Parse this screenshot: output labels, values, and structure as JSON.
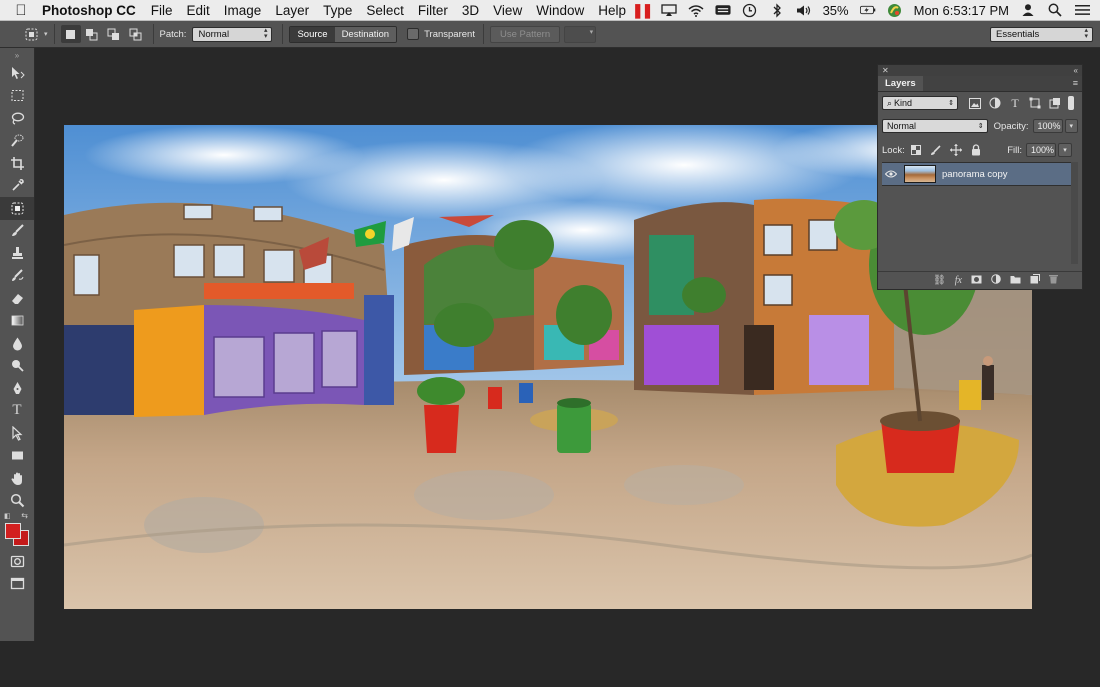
{
  "menubar": {
    "app_name": "Photoshop CC",
    "menus": [
      "File",
      "Edit",
      "Image",
      "Layer",
      "Type",
      "Select",
      "Filter",
      "3D",
      "View",
      "Window",
      "Help"
    ],
    "battery": "35%",
    "clock": "Mon 6:53:17 PM"
  },
  "options_bar": {
    "patch_label": "Patch:",
    "patch_mode": "Normal",
    "source_label": "Source",
    "destination_label": "Destination",
    "transparent_label": "Transparent",
    "use_pattern_label": "Use Pattern",
    "workspace": "Essentials"
  },
  "layers_panel": {
    "title": "Layers",
    "filter_kind": "Kind",
    "blend_mode": "Normal",
    "opacity_label": "Opacity:",
    "opacity_value": "100%",
    "lock_label": "Lock:",
    "fill_label": "Fill:",
    "fill_value": "100%",
    "layers": [
      {
        "name": "panorama copy",
        "visible": true,
        "selected": true
      }
    ]
  },
  "colors": {
    "foreground": "#d22020",
    "background": "#c41a1a",
    "selected_layer": "#5b6d85"
  }
}
